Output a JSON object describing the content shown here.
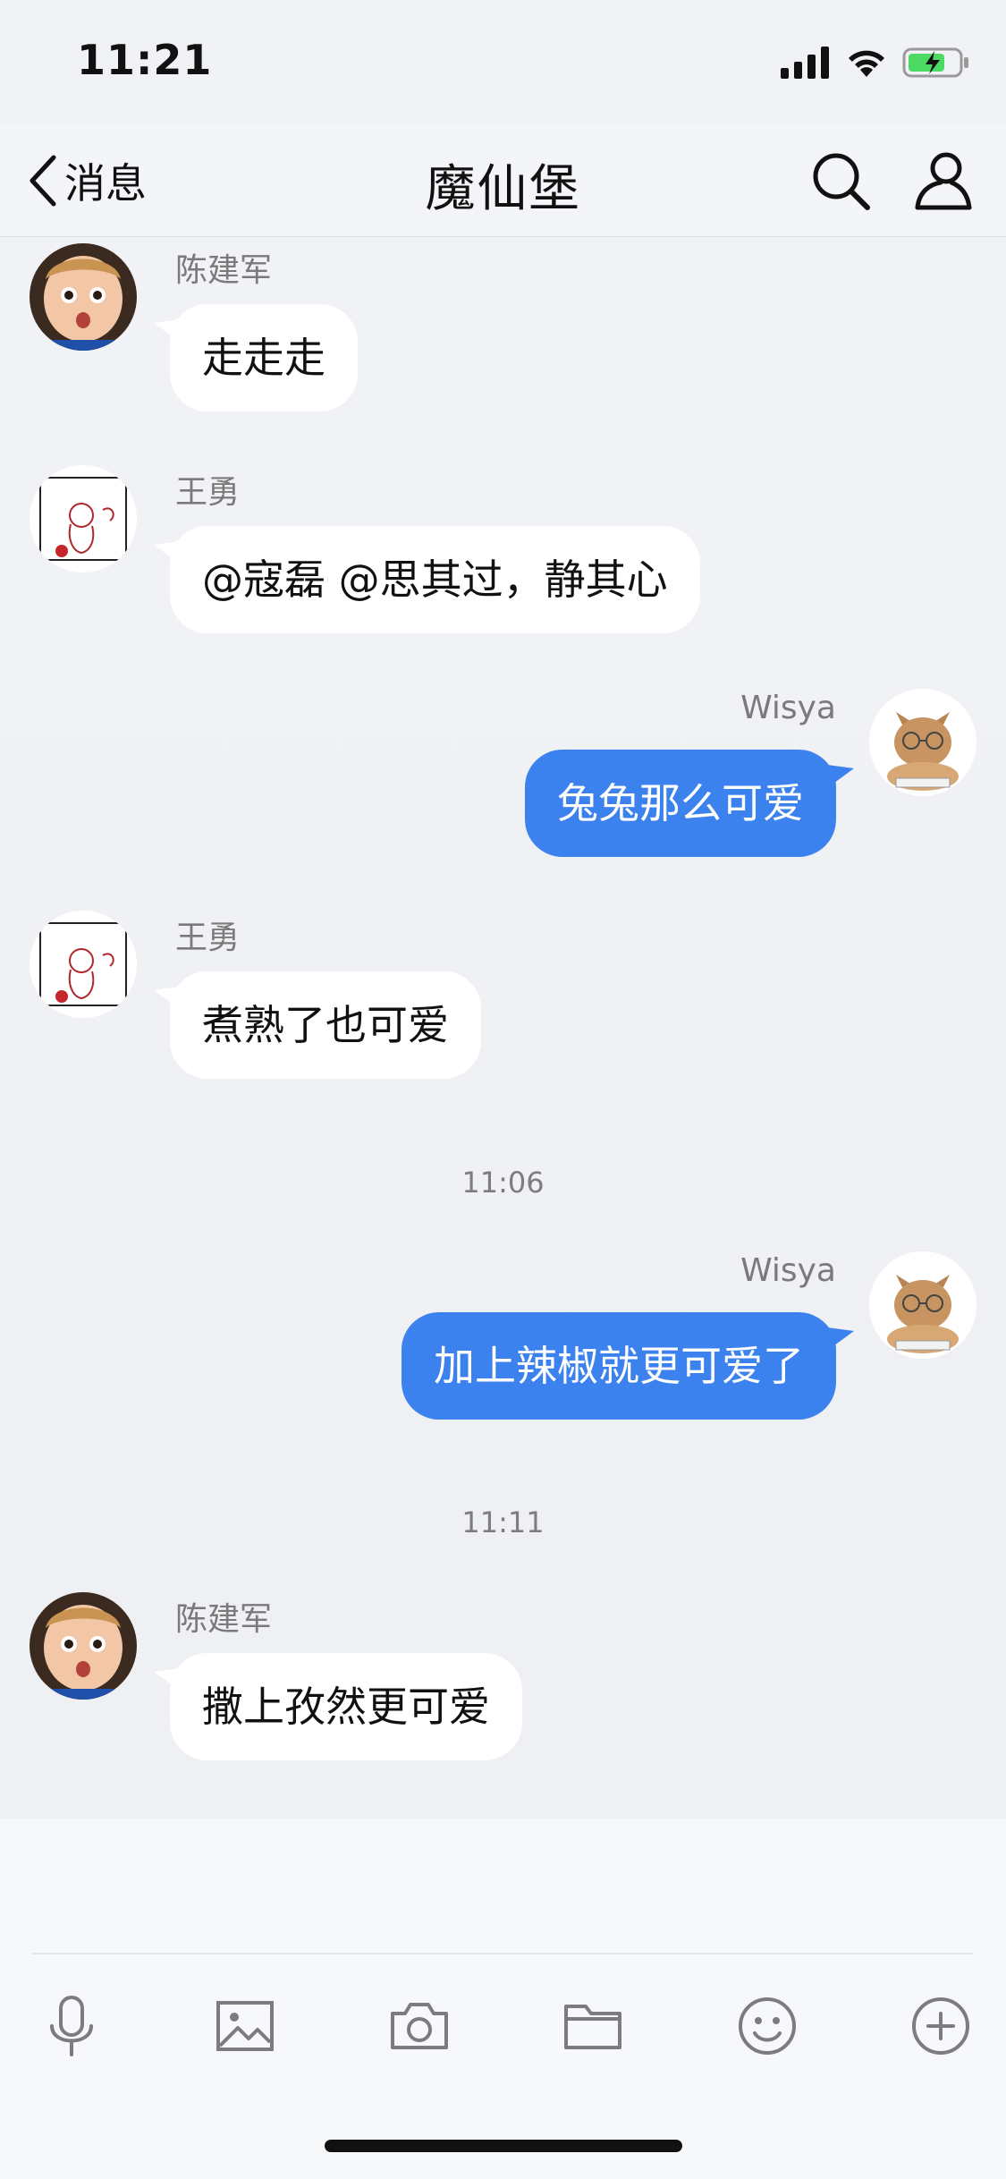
{
  "status_bar": {
    "time": "11:21"
  },
  "nav": {
    "back_label": "消息",
    "title": "魔仙堡"
  },
  "messages": [
    {
      "side": "in",
      "sender": "陈建军",
      "text": "走走走",
      "avatar": "boy-avatar"
    },
    {
      "side": "in",
      "sender": "王勇",
      "text": "@寇磊 @思其过，静其心",
      "avatar": "sketch-avatar"
    },
    {
      "side": "out",
      "sender": "Wisya",
      "text": "兔兔那么可爱",
      "avatar": "cat-avatar"
    },
    {
      "side": "in",
      "sender": "王勇",
      "text": "煮熟了也可爱",
      "avatar": "sketch-avatar"
    },
    {
      "side": "out",
      "sender": "Wisya",
      "text": "加上辣椒就更可爱了",
      "avatar": "cat-avatar"
    },
    {
      "side": "in",
      "sender": "陈建军",
      "text": "撒上孜然更可爱",
      "avatar": "boy-avatar"
    }
  ],
  "timestamps": [
    "11:06",
    "11:11"
  ],
  "toolbar": {
    "icons": [
      "microphone-icon",
      "image-icon",
      "camera-icon",
      "folder-icon",
      "emoji-icon",
      "plus-icon"
    ]
  },
  "colors": {
    "outgoing_bubble": "#3b82ef",
    "incoming_bubble": "#ffffff",
    "background": "#f1f2f6"
  }
}
